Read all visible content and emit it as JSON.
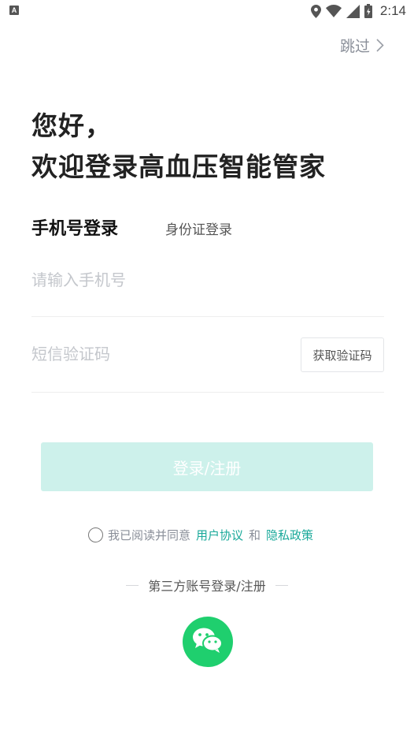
{
  "status_bar": {
    "left_icon_letter": "A",
    "time": "2:14",
    "icons": [
      "location-icon",
      "wifi-icon",
      "signal-icon",
      "battery-icon"
    ]
  },
  "header": {
    "skip_label": "跳过",
    "skip_icon": "chevron-right-icon"
  },
  "greeting": {
    "line1": "您好，",
    "line2": "欢迎登录高血压智能管家"
  },
  "tabs": {
    "active_label": "手机号登录",
    "inactive_label": "身份证登录"
  },
  "form": {
    "phone_placeholder": "请输入手机号",
    "phone_value": "",
    "code_placeholder": "短信验证码",
    "code_value": "",
    "get_code_label": "获取验证码",
    "submit_label": "登录/注册"
  },
  "agreement": {
    "prefix": "我已阅读并同意",
    "user_agreement": "用户协议",
    "conjunction": "和",
    "privacy_policy": "隐私政策",
    "checked": false
  },
  "third_party": {
    "label": "第三方账号登录/注册",
    "providers": [
      "wechat-icon"
    ]
  },
  "colors": {
    "accent": "#1aa99a",
    "submit_disabled_bg": "#cdf1eb",
    "tab_underline": "#c8f1e9",
    "wechat_green": "#1fcf6e",
    "placeholder": "#c4c7cc"
  }
}
